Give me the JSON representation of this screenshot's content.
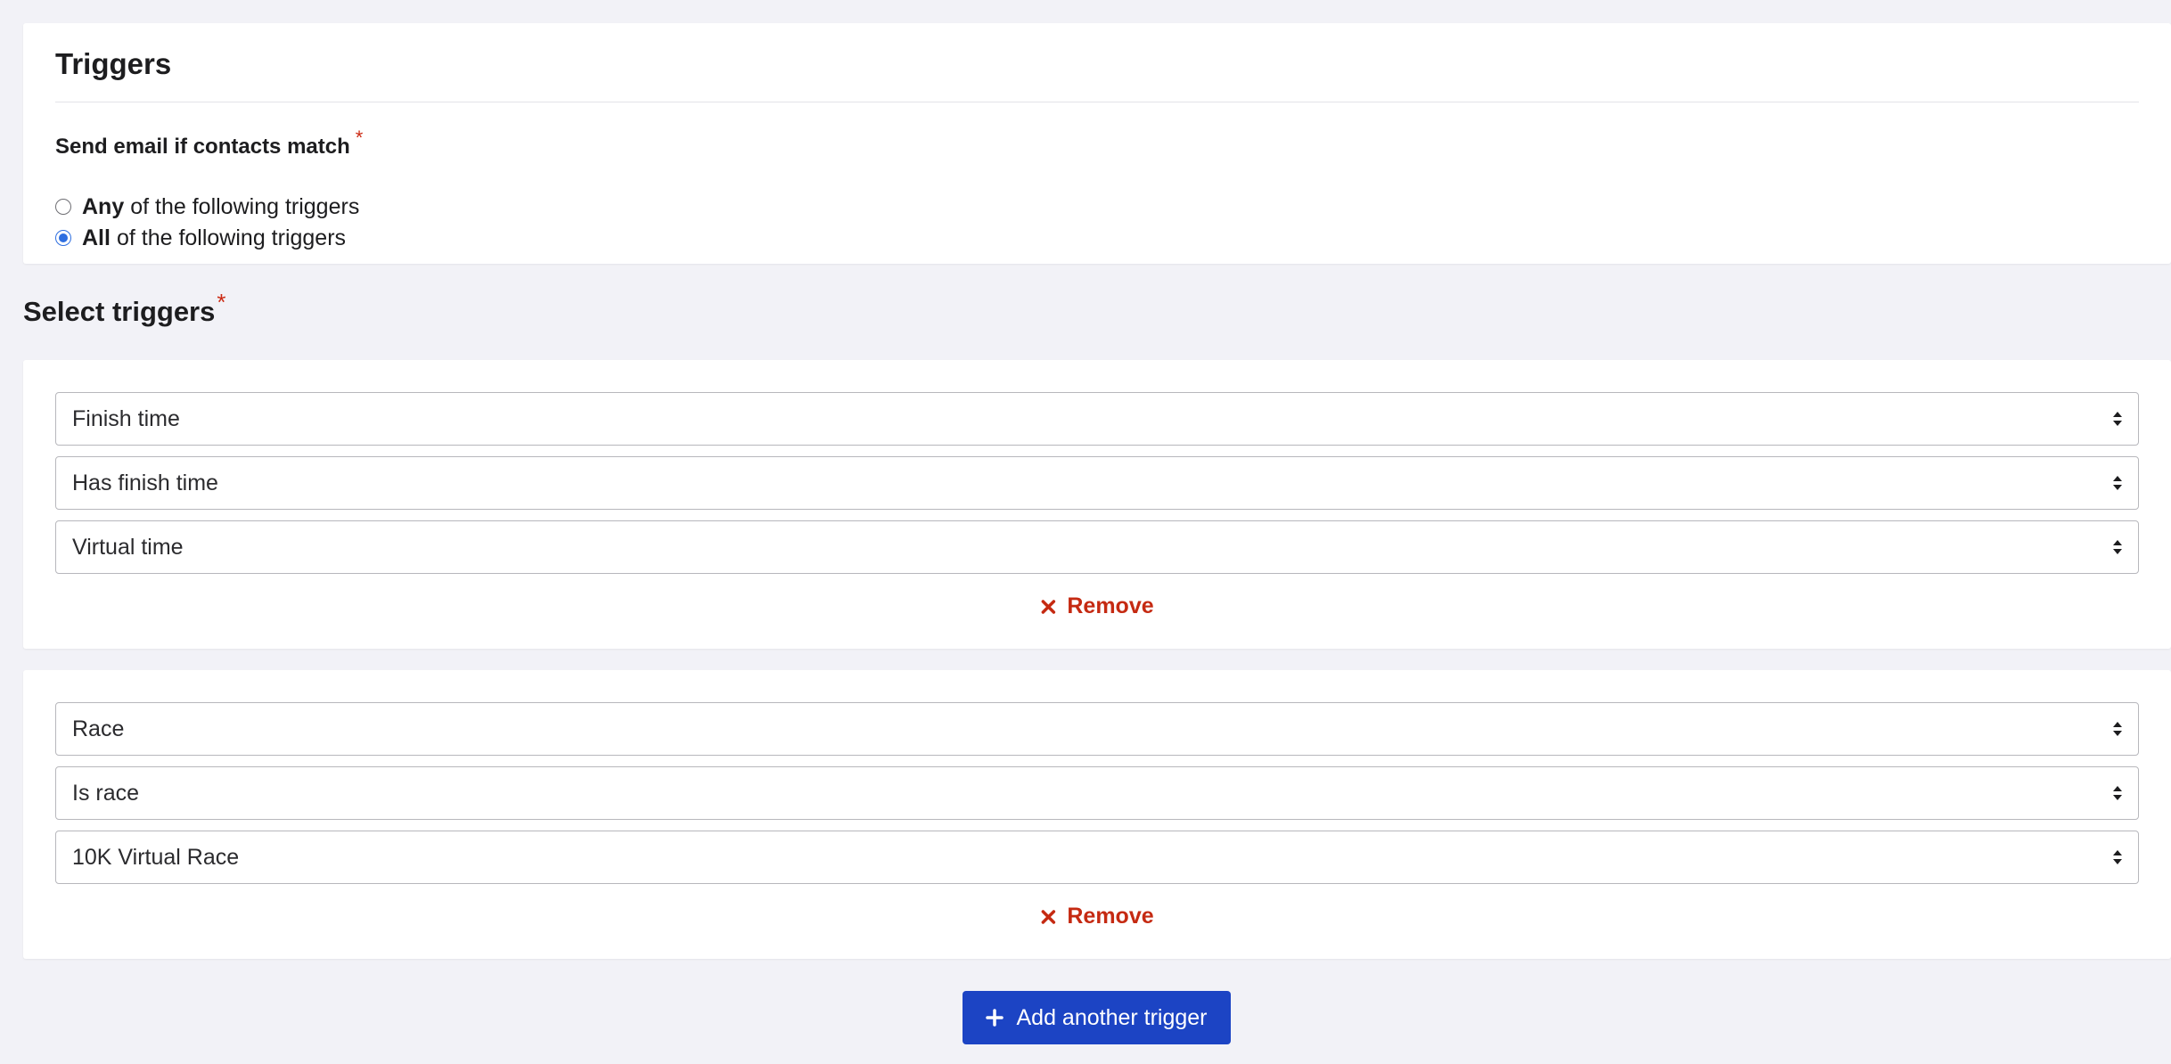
{
  "triggers_card": {
    "title": "Triggers",
    "match_label": "Send email if contacts match",
    "required_mark": "*",
    "options": [
      {
        "strong": "Any",
        "rest": "of the following triggers",
        "checked": false
      },
      {
        "strong": "All",
        "rest": "of the following triggers",
        "checked": true
      }
    ]
  },
  "select_triggers": {
    "heading": "Select triggers",
    "required_mark": "*"
  },
  "trigger_groups": [
    {
      "field": "Finish time",
      "condition": "Has finish time",
      "value": "Virtual time",
      "remove_label": "Remove"
    },
    {
      "field": "Race",
      "condition": "Is race",
      "value": "10K Virtual Race",
      "remove_label": "Remove"
    }
  ],
  "add_button": {
    "label": "Add another trigger",
    "icon": "plus-icon"
  },
  "colors": {
    "page_background": "#f2f2f7",
    "required": "#cc2b14",
    "remove": "#c52a12",
    "primary_button": "#1c44c4",
    "radio_checked": "#2f6fe0"
  }
}
